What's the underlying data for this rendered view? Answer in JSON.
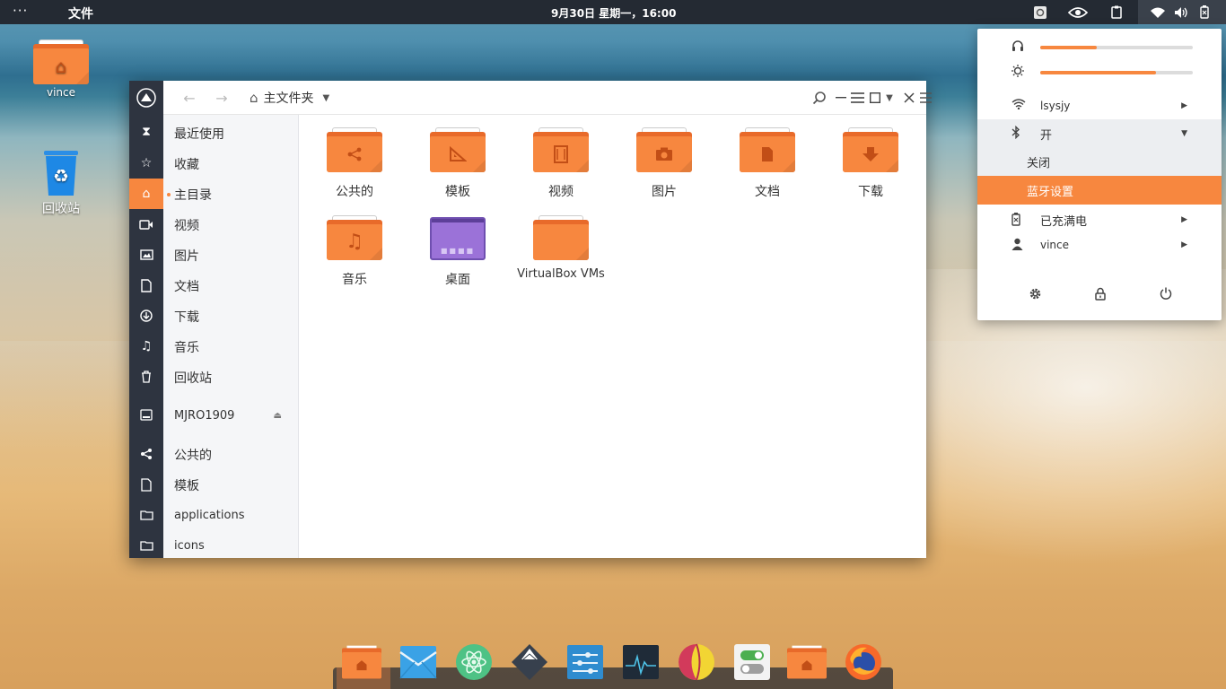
{
  "topbar": {
    "menu_dots": "···",
    "app_title": "文件",
    "clock": "9月30日 星期一，16:00",
    "tray_icons": [
      "screenshot-icon",
      "nvidia-icon",
      "clipboard-icon",
      "wifi-icon",
      "volume-icon",
      "battery-icon"
    ]
  },
  "desktop": {
    "icons": [
      {
        "label": "vince",
        "icon": "home-folder-icon"
      },
      {
        "label": "回收站",
        "icon": "recycle-bin-icon"
      }
    ]
  },
  "file_manager": {
    "breadcrumb": "主文件夹",
    "rail_icons": [
      "app-logo-icon",
      "recent-icon",
      "star-icon",
      "home-icon",
      "video-icon",
      "image-icon",
      "document-icon",
      "download-icon",
      "music-icon",
      "trash-icon",
      "drive-icon",
      "share-icon",
      "template-icon",
      "folder-icon",
      "folder-icon"
    ],
    "sidebar": {
      "items": [
        {
          "label": "最近使用"
        },
        {
          "label": "收藏"
        },
        {
          "label": "主目录",
          "active": true
        },
        {
          "label": "视频"
        },
        {
          "label": "图片"
        },
        {
          "label": "文档"
        },
        {
          "label": "下载"
        },
        {
          "label": "音乐"
        },
        {
          "label": "回收站"
        }
      ],
      "device": {
        "label": "MJRO1909"
      },
      "bookmarks": [
        {
          "label": "公共的"
        },
        {
          "label": "模板"
        },
        {
          "label": "applications"
        },
        {
          "label": "icons"
        }
      ]
    },
    "files": [
      {
        "name": "公共的",
        "glyph": "share"
      },
      {
        "name": "模板",
        "glyph": "template"
      },
      {
        "name": "视频",
        "glyph": "video"
      },
      {
        "name": "图片",
        "glyph": "camera"
      },
      {
        "name": "文档",
        "glyph": "document"
      },
      {
        "name": "下载",
        "glyph": "download"
      },
      {
        "name": "音乐",
        "glyph": "music"
      },
      {
        "name": "桌面",
        "glyph": "desktop"
      },
      {
        "name": "VirtualBox VMs",
        "glyph": "none"
      }
    ]
  },
  "system_menu": {
    "volume_level": 0.37,
    "brightness_level": 0.76,
    "wifi": {
      "label": "lsysjy"
    },
    "bluetooth": {
      "label": "开",
      "expanded": true
    },
    "bluetooth_off": "关闭",
    "bluetooth_settings": "蓝牙设置",
    "battery": {
      "label": "已充满电"
    },
    "user": {
      "label": "vince"
    }
  },
  "dock": {
    "apps": [
      "files-icon",
      "mail-icon",
      "atom-icon",
      "inkscape-icon",
      "settings-tweak-icon",
      "system-monitor-icon",
      "color-picker-icon",
      "toggle-settings-icon",
      "home-folder-icon",
      "firefox-icon"
    ]
  },
  "colors": {
    "accent": "#f7873f",
    "panel": "#242a33",
    "rail": "#2e3440"
  }
}
